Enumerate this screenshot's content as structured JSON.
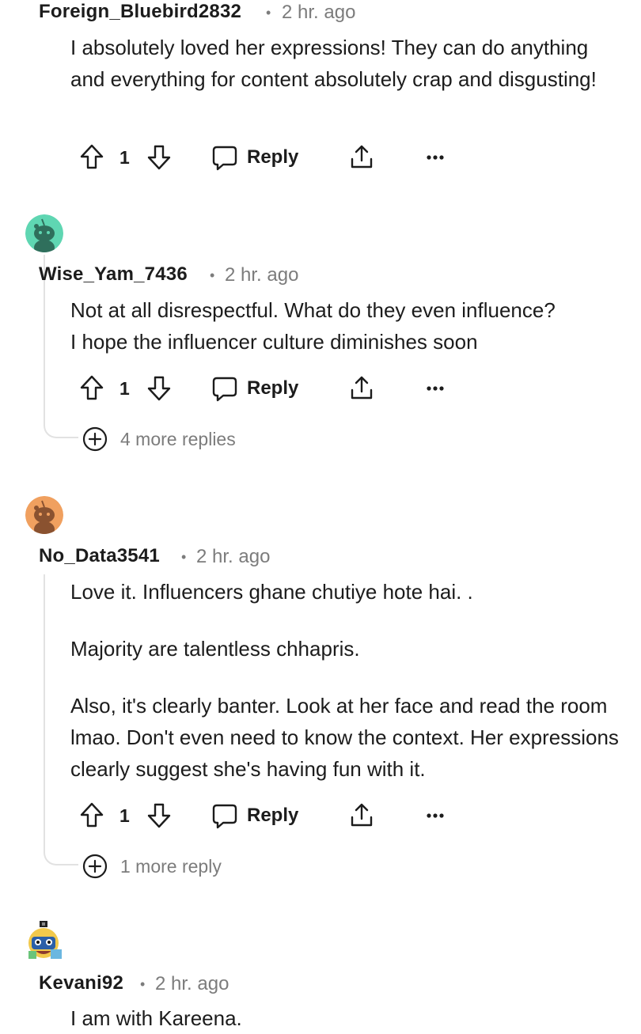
{
  "comments": [
    {
      "username": "Foreign_Bluebird2832",
      "time": "2 hr. ago",
      "body": "I absolutely loved her expressions! They can do anything and everything for content absolutely crap and disgusting!",
      "votes": "1",
      "reply_label": "Reply"
    },
    {
      "username": "Wise_Yam_7436",
      "time": "2 hr. ago",
      "avatar_color": "#5fd6b2",
      "body": "Not at all disrespectful. What do they even influence?\nI hope the influencer culture diminishes soon",
      "votes": "1",
      "reply_label": "Reply",
      "more_replies": "4 more replies"
    },
    {
      "username": "No_Data3541",
      "time": "2 hr. ago",
      "avatar_color": "#f0a05f",
      "body_paragraphs": [
        "Love it. Influencers ghane chutiye hote hai. .",
        "Majority are talentless chhapris.",
        "Also, it's clearly banter. Look at her face and read the room lmao. Don't even need to know the context. Her expressions clearly suggest she's having fun with it."
      ],
      "votes": "1",
      "reply_label": "Reply",
      "more_replies": "1 more reply"
    },
    {
      "username": "Kevani92",
      "time": "2 hr. ago",
      "body": "I am with Kareena."
    }
  ],
  "separator": "•",
  "icons": [
    "upvote-icon",
    "downvote-icon",
    "comment-icon",
    "share-icon",
    "more-options-icon",
    "expand-plus-icon",
    "avatar-icon"
  ]
}
